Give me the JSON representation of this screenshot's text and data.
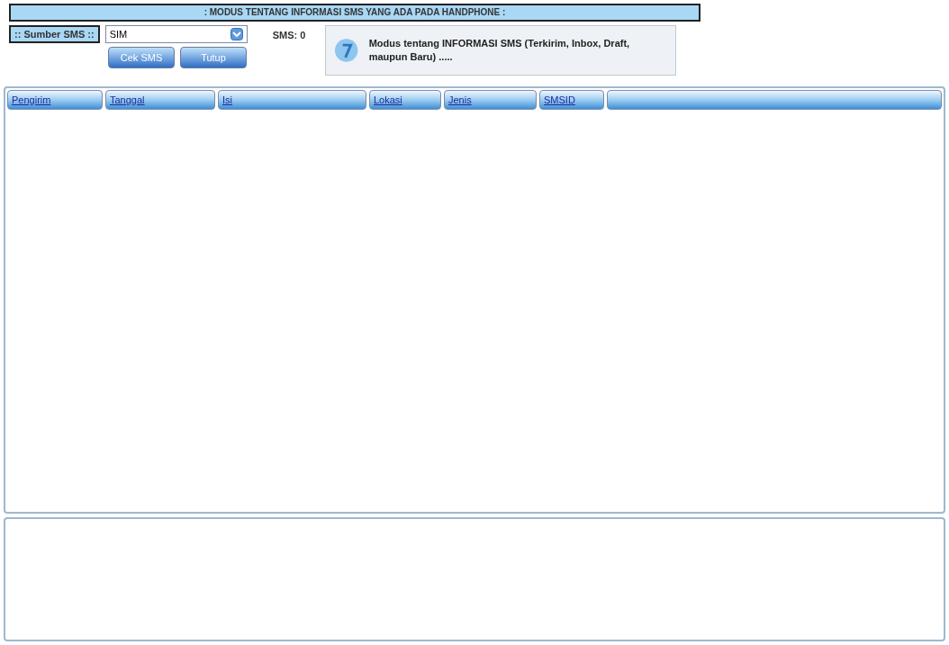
{
  "title": ": MODUS TENTANG INFORMASI SMS YANG ADA PADA HANDPHONE :",
  "source": {
    "label": ":: Sumber SMS ::",
    "value": "SIM"
  },
  "count": "SMS: 0",
  "buttons": [
    "Cek SMS",
    "Tutup"
  ],
  "info": "Modus tentang INFORMASI SMS (Terkirim, Inbox, Draft, maupun Baru) .....",
  "table": {
    "columns": [
      "Pengirim",
      "Tanggal",
      "Isi",
      "Lokasi",
      "Jenis",
      "SMSID"
    ]
  }
}
